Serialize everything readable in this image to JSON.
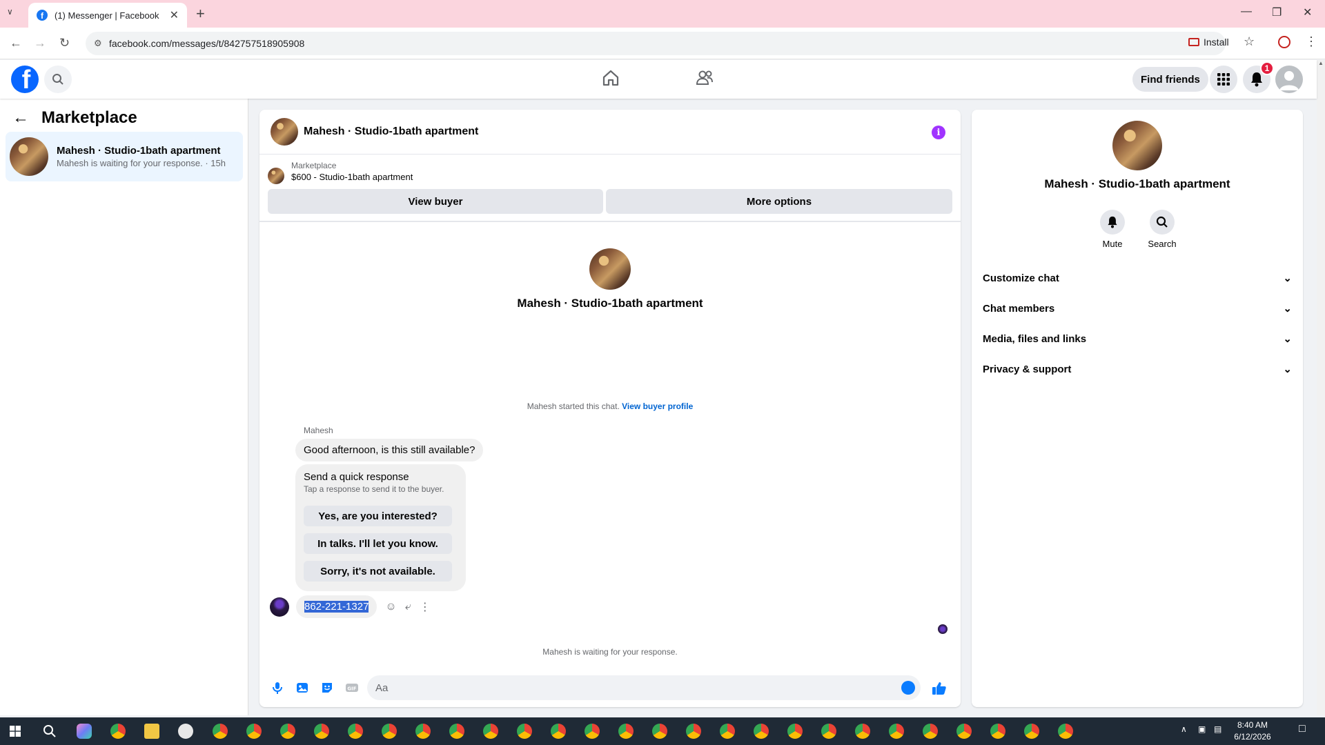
{
  "browser": {
    "tab_title": "(1) Messenger | Facebook",
    "url": "facebook.com/messages/t/842757518905908",
    "install_label": "Install"
  },
  "fb_header": {
    "find_friends_label": "Find friends",
    "notification_count": "1"
  },
  "sidebar": {
    "title": "Marketplace",
    "conversation": {
      "name": "Mahesh · Studio-1bath apartment",
      "preview": "Mahesh is waiting for your response. · 15h"
    }
  },
  "chat": {
    "title": "Mahesh · Studio-1bath apartment",
    "listing": {
      "category": "Marketplace",
      "price_title": "$600 - Studio-1bath apartment"
    },
    "buttons": {
      "view_buyer": "View buyer",
      "more_options": "More options"
    },
    "intro_name": "Mahesh · Studio-1bath apartment",
    "started_text": "Mahesh started this chat.",
    "view_buyer_profile": "View buyer profile",
    "sender_name": "Mahesh",
    "incoming_message": "Good afternoon, is this still available?",
    "quick_response": {
      "heading": "Send a quick response",
      "subtext": "Tap a response to send it to the buyer.",
      "options": [
        "Yes, are you interested?",
        "In talks. I'll let you know.",
        "Sorry, it's not available."
      ]
    },
    "outgoing_message": "862-221-1327",
    "waiting_text": "Mahesh is waiting for your response.",
    "input_placeholder": "Aa"
  },
  "details": {
    "name": "Mahesh · Studio-1bath apartment",
    "actions": {
      "mute": "Mute",
      "search": "Search"
    },
    "sections": [
      "Customize chat",
      "Chat members",
      "Media, files and links",
      "Privacy & support"
    ]
  },
  "taskbar": {
    "time": "8:40 AM",
    "date": "6/12/2026"
  },
  "colors": {
    "fb_blue": "#0866ff",
    "messenger_blue": "#0a7cff",
    "info_purple": "#a033ff",
    "notification_red": "#e41e3f",
    "tabstrip_pink": "#fbd5de"
  }
}
